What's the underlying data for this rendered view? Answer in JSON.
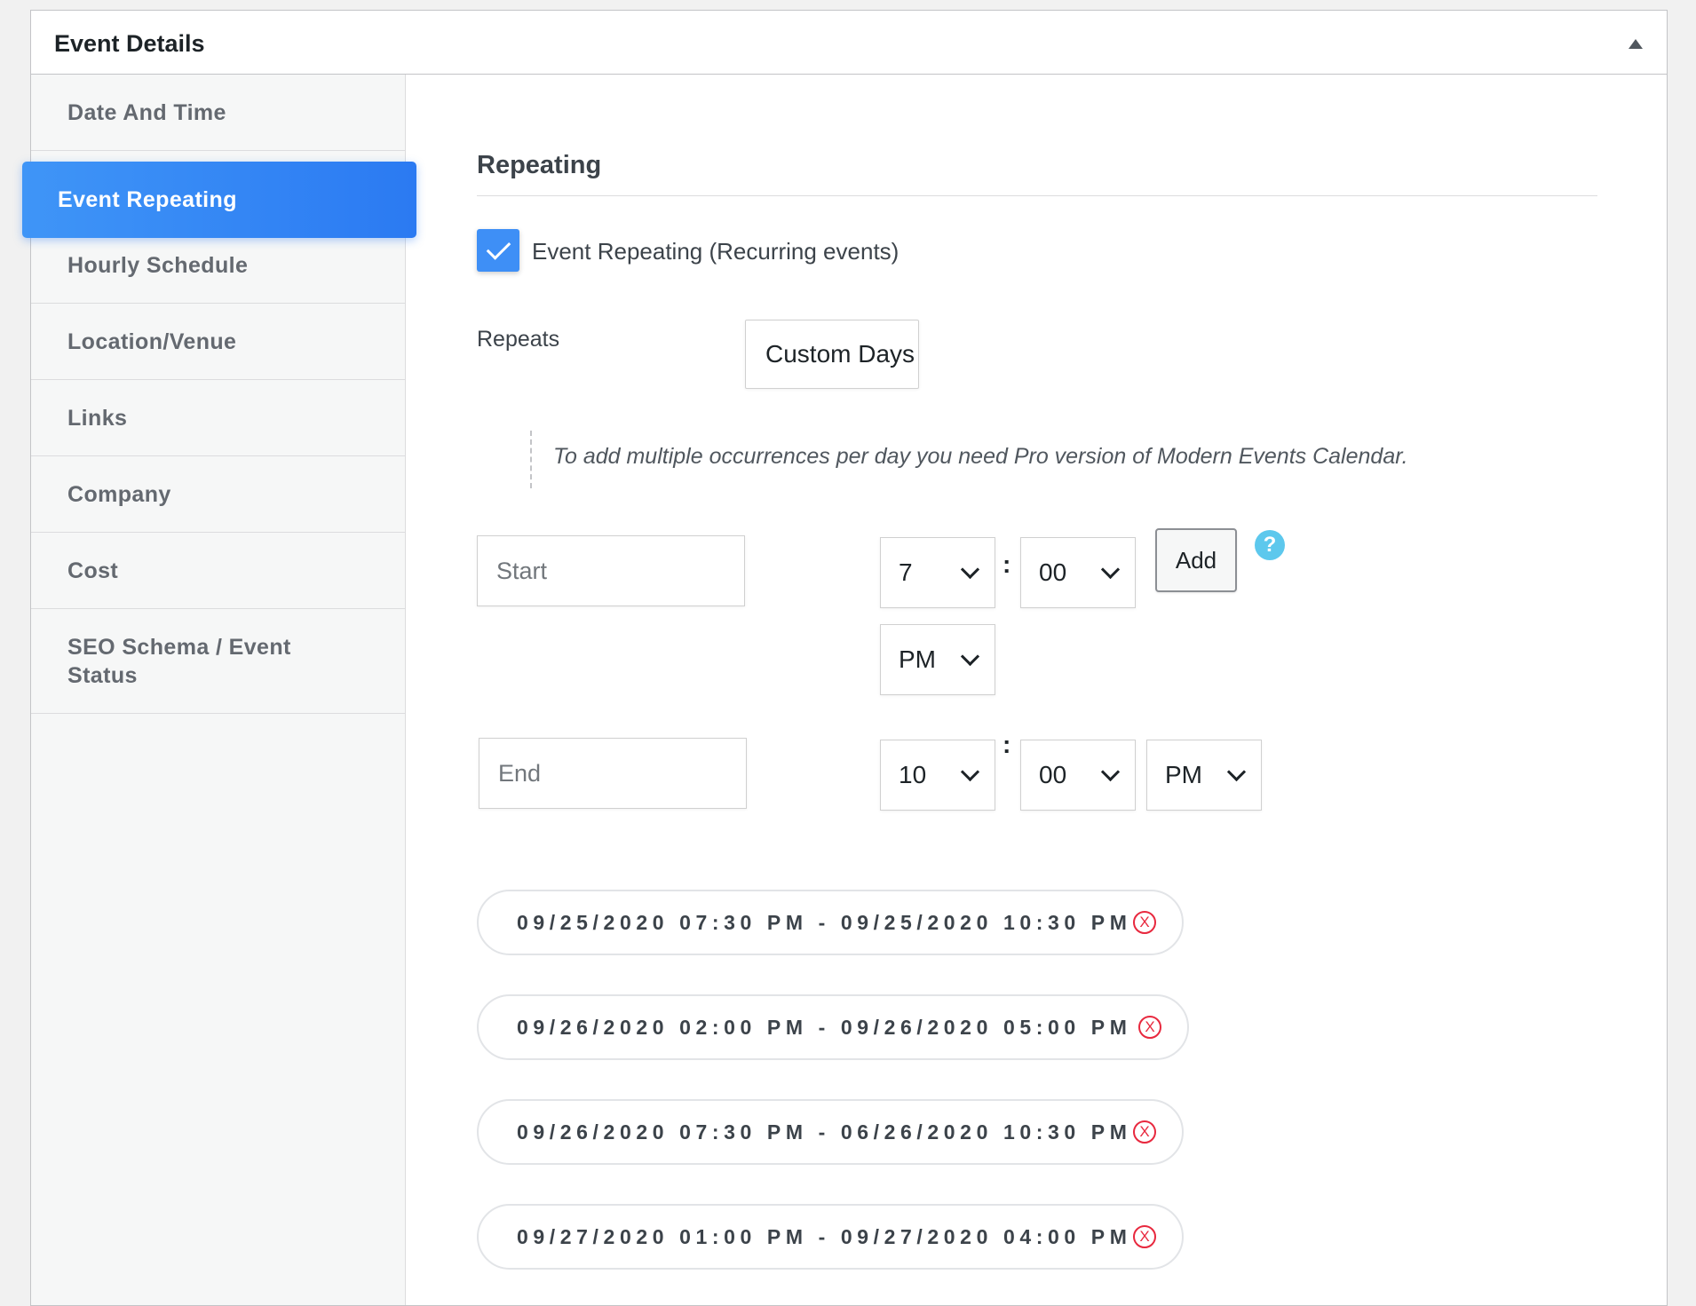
{
  "panel": {
    "title": "Event Details"
  },
  "sidebar": {
    "items": [
      {
        "label": "Date And Time"
      },
      {
        "label": "Event Repeating",
        "active": true
      },
      {
        "label": "Hourly Schedule"
      },
      {
        "label": "Location/Venue"
      },
      {
        "label": "Links"
      },
      {
        "label": "Company"
      },
      {
        "label": "Cost"
      },
      {
        "label": "SEO Schema / Event Status"
      }
    ]
  },
  "repeating": {
    "section_title": "Repeating",
    "checkbox_label": "Event Repeating (Recurring events)",
    "checkbox_checked": true,
    "repeats_label": "Repeats",
    "repeats_value": "Custom Days",
    "note": "To add multiple occurrences per day you need Pro version of Modern Events Calendar.",
    "start": {
      "placeholder": "Start",
      "hour": "7",
      "minute": "00",
      "ampm": "PM"
    },
    "end": {
      "placeholder": "End",
      "hour": "10",
      "minute": "00",
      "ampm": "PM"
    },
    "time_separator": ":",
    "add_label": "Add",
    "help_glyph": "?",
    "occurrences": [
      "09/25/2020 07:30 PM - 09/25/2020 10:30 PM",
      "09/26/2020 02:00 PM - 09/26/2020 05:00 PM",
      "09/26/2020 07:30 PM - 06/26/2020 10:30 PM",
      "09/27/2020 01:00 PM - 09/27/2020 04:00 PM"
    ],
    "remove_glyph": "X"
  },
  "colors": {
    "accent": "#2b7af2",
    "checkbox": "#3e8ff6",
    "help_icon": "#5dc8ed",
    "remove_icon": "#e8283e"
  },
  "icons": {
    "collapse": "triangle-up-icon",
    "check": "checkmark-icon",
    "help": "question-circle-icon",
    "remove": "x-circle-icon",
    "dropdown": "chevron-down-icon"
  }
}
